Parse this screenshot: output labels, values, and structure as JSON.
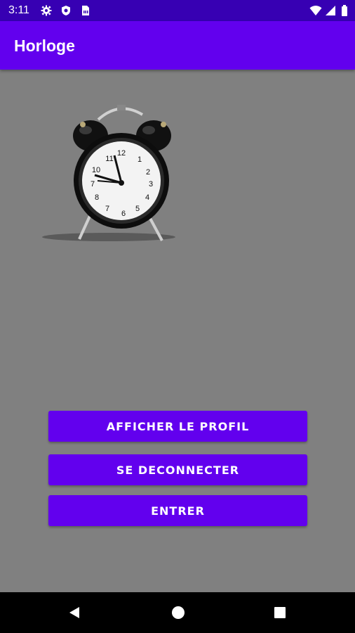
{
  "status_bar": {
    "time": "3:11",
    "left_icons": [
      "gear-icon",
      "shield-icon",
      "sim-card-icon"
    ],
    "right_icons": [
      "wifi-icon",
      "signal-icon",
      "battery-icon"
    ]
  },
  "app_bar": {
    "title": "Horloge",
    "color": "#6200ee"
  },
  "content": {
    "image": "alarm-clock-image",
    "background": "#808080"
  },
  "buttons": {
    "profile_label": "AFFICHER LE PROFIL",
    "logout_label": "SE DECONNECTER",
    "enter_label": "ENTRER",
    "color": "#6200ee"
  },
  "nav_bar": {
    "icons": [
      "back-icon",
      "home-icon",
      "recents-icon"
    ]
  }
}
